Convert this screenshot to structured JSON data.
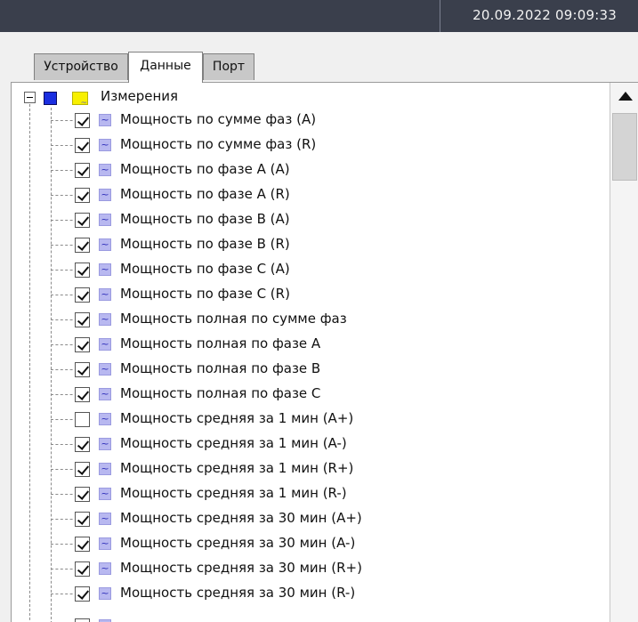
{
  "header": {
    "datetime": "20.09.2022  09:09:33"
  },
  "tabs": [
    {
      "label": "Устройство",
      "active": false
    },
    {
      "label": "Данные",
      "active": true
    },
    {
      "label": "Порт",
      "active": false
    }
  ],
  "tree": {
    "root": {
      "label": "Измерения",
      "expanded": true,
      "checked": true,
      "icon": "folder-wave-icon"
    },
    "items": [
      {
        "label": "Мощность по сумме фаз (A)",
        "checked": true
      },
      {
        "label": "Мощность по сумме фаз (R)",
        "checked": true
      },
      {
        "label": "Мощность по фазе A (A)",
        "checked": true
      },
      {
        "label": "Мощность по фазе A (R)",
        "checked": true
      },
      {
        "label": "Мощность по фазе B (A)",
        "checked": true
      },
      {
        "label": "Мощность по фазе B (R)",
        "checked": true
      },
      {
        "label": "Мощность по фазе C (A)",
        "checked": true
      },
      {
        "label": "Мощность по фазе C (R)",
        "checked": true
      },
      {
        "label": "Мощность полная по сумме фаз",
        "checked": true
      },
      {
        "label": "Мощность полная по фазе A",
        "checked": true
      },
      {
        "label": "Мощность полная по фазе B",
        "checked": true
      },
      {
        "label": "Мощность полная по фазе C",
        "checked": true
      },
      {
        "label": "Мощность средняя за 1 мин (A+)",
        "checked": false
      },
      {
        "label": "Мощность средняя за 1 мин (A-)",
        "checked": true
      },
      {
        "label": "Мощность средняя за 1 мин (R+)",
        "checked": true
      },
      {
        "label": "Мощность средняя за 1 мин (R-)",
        "checked": true
      },
      {
        "label": "Мощность средняя за 30 мин (A+)",
        "checked": true
      },
      {
        "label": "Мощность средняя за 30 мин (A-)",
        "checked": true
      },
      {
        "label": "Мощность средняя за 30 мин (R+)",
        "checked": true
      },
      {
        "label": "Мощность средняя за 30 мин (R-)",
        "checked": true
      }
    ]
  },
  "scrollbar": {
    "up_icon": "triangle-up-icon",
    "position": 0.0
  }
}
